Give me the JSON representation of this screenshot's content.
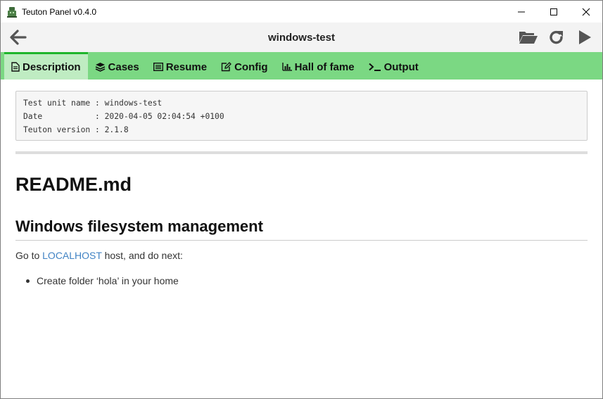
{
  "window": {
    "title": "Teuton Panel v0.4.0",
    "controls": [
      "minimize",
      "maximize",
      "close"
    ]
  },
  "header": {
    "title": "windows-test",
    "icons": [
      "back-arrow-icon",
      "folder-open-icon",
      "refresh-icon",
      "play-icon"
    ]
  },
  "tabs": [
    {
      "label": "Description",
      "icon": "file-icon",
      "active": true
    },
    {
      "label": "Cases",
      "icon": "layers-icon",
      "active": false
    },
    {
      "label": "Resume",
      "icon": "list-icon",
      "active": false
    },
    {
      "label": "Config",
      "icon": "edit-icon",
      "active": false
    },
    {
      "label": "Hall of fame",
      "icon": "bar-chart-icon",
      "active": false
    },
    {
      "label": "Output",
      "icon": "terminal-icon",
      "active": false
    }
  ],
  "info": {
    "line1": "Test unit name : windows-test",
    "line2": "Date           : 2020-04-05 02:04:54 +0100",
    "line3": "Teuton version : 2.1.8"
  },
  "readme": {
    "title": "README.md",
    "heading": "Windows filesystem management",
    "para_prefix": "Go to ",
    "para_link": "LOCALHOST",
    "para_suffix": " host, and do next:",
    "items": [
      "Create folder ‘hola’ in your home"
    ]
  },
  "colors": {
    "tabbar": "#7bd883",
    "tab_active": "#bfecc2",
    "tab_active_border": "#1fb52b",
    "link": "#4183c4"
  }
}
